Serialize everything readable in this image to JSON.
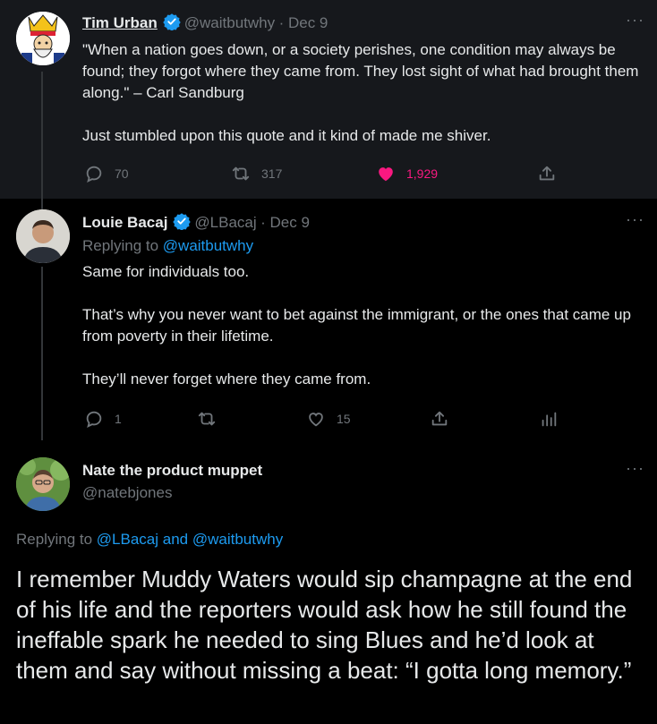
{
  "colors": {
    "like": "#f91880",
    "link": "#1d9bf0",
    "muted": "#71767b",
    "verified": "#1d9bf0"
  },
  "tweet1": {
    "name": "Tim Urban",
    "handle": "@waitbutwhy",
    "time": "· Dec 9",
    "text": [
      "\"When a nation goes down, or a society perishes, one condition may always be found; they forgot where they came from. They lost sight of what had brought them along.\" – Carl Sandburg",
      "Just stumbled upon this quote and it kind of made me shiver."
    ],
    "replies": "70",
    "retweets": "317",
    "likes": "1,929"
  },
  "tweet2": {
    "name": "Louie Bacaj",
    "handle": "@LBacaj",
    "time": "· Dec 9",
    "replying_prefix": "Replying to ",
    "replying_to": "@waitbutwhy",
    "text": [
      "Same for individuals too.",
      "That’s why you never want to bet against the immigrant, or the ones that came up from poverty in their lifetime.",
      "They’ll never forget where they came from."
    ],
    "replies": "1",
    "likes": "15"
  },
  "tweet3": {
    "name": "Nate the product muppet",
    "handle": "@natebjones",
    "replying_prefix": "Replying to ",
    "replying_to_1": "@LBacaj",
    "replying_and": " and ",
    "replying_to_2": "@waitbutwhy",
    "text": "I remember Muddy Waters would sip champagne at the end of his life and the reporters would ask how he still found the ineffable spark he needed to sing Blues and he’d look at them and say without missing a beat: “I gotta long memory.”"
  }
}
